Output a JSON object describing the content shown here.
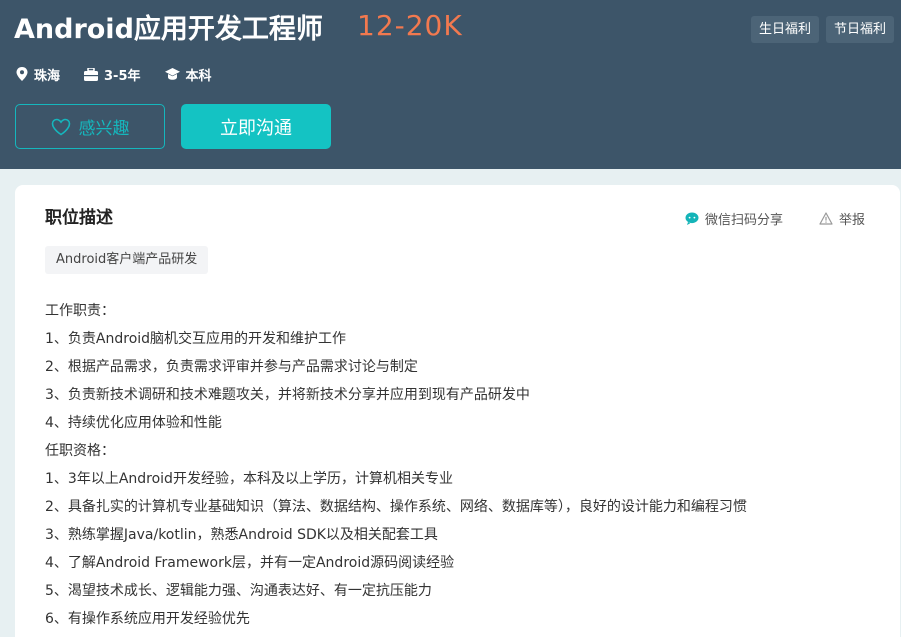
{
  "job": {
    "title": "Android应用开发工程师",
    "salary": "12-20K",
    "benefit_tags": [
      "生日福利",
      "节日福利"
    ],
    "location": "珠海",
    "experience": "3-5年",
    "education": "本科"
  },
  "actions": {
    "interest_label": "感兴趣",
    "chat_label": "立即沟通"
  },
  "colors": {
    "header_bg": "#3d5569",
    "accent": "#14c3c3",
    "salary": "#f2794f"
  },
  "description": {
    "section_title": "职位描述",
    "share_label": "微信扫码分享",
    "report_label": "举报",
    "skill_tag": "Android客户端产品研发",
    "lines": [
      "工作职责：",
      "1、负责Android脑机交互应用的开发和维护工作",
      "2、根据产品需求，负责需求评审并参与产品需求讨论与制定",
      "3、负责新技术调研和技术难题攻关，并将新技术分享并应用到现有产品研发中",
      "4、持续优化应用体验和性能",
      "任职资格：",
      "1、3年以上Android开发经验，本科及以上学历，计算机相关专业",
      "2、具备扎实的计算机专业基础知识（算法、数据结构、操作系统、网络、数据库等），良好的设计能力和编程习惯",
      "3、熟练掌握Java/kotlin，熟悉Android SDK以及相关配套工具",
      "4、了解Android Framework层，并有一定Android源码阅读经验",
      "5、渴望技术成长、逻辑能力强、沟通表达好、有一定抗压能力",
      "6、有操作系统应用开发经验优先"
    ]
  }
}
